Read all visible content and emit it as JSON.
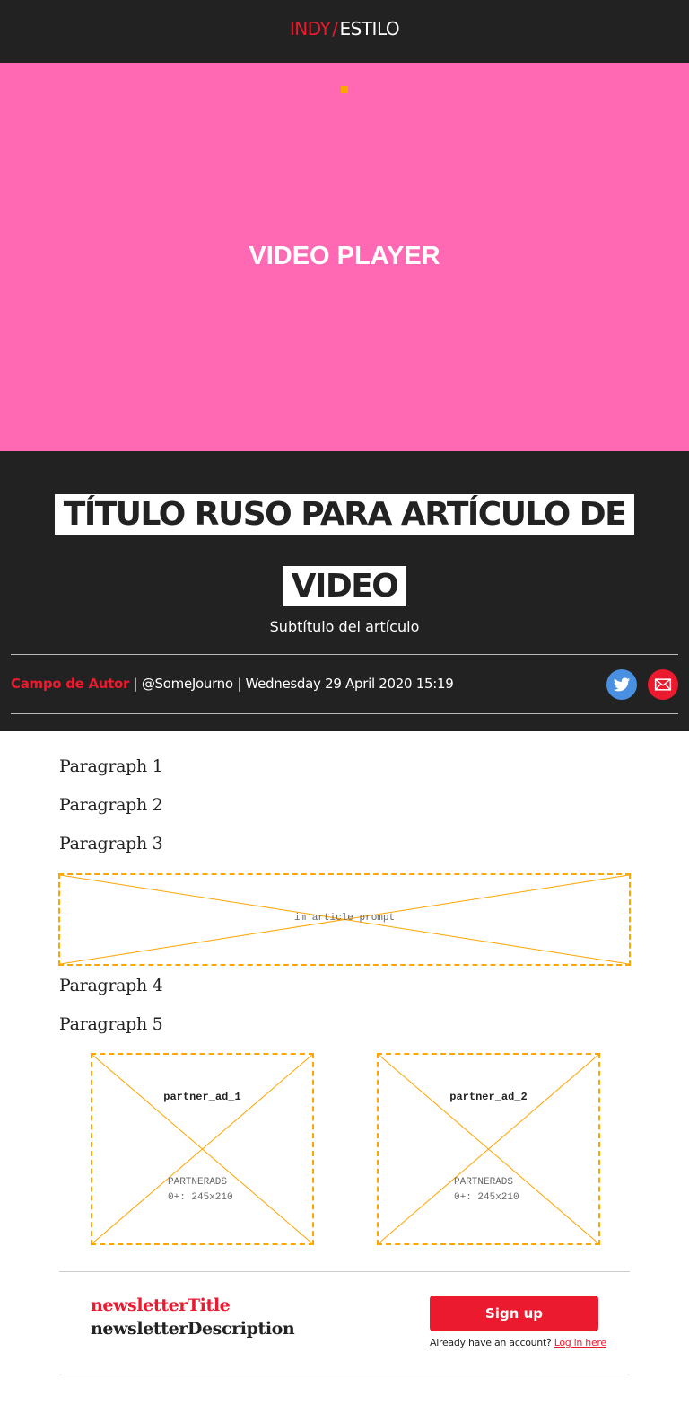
{
  "colors": {
    "brand_red": "#ec1a2e",
    "dark": "#222222",
    "video_bg": "#ff69b4",
    "placeholder": "#ffa500",
    "twitter": "#4a90e2"
  },
  "header": {
    "logo_indy": "INDY",
    "logo_slash": "/",
    "logo_estilo": "ESTILO",
    "corner_icon": "expand-arrows-icon"
  },
  "video": {
    "label": "VIDEO PLAYER"
  },
  "article": {
    "title": "TÍTULO RUSO PARA ARTÍCULO DE VIDEO",
    "subtitle": "Subtítulo del artículo",
    "author": "Campo de Autor",
    "separator": "|",
    "handle": "@SomeJourno",
    "date": "Wednesday 29 April 2020 15:19",
    "share_icons": [
      "twitter-icon",
      "email-icon"
    ]
  },
  "body": {
    "paragraphs": [
      "Paragraph 1",
      "Paragraph 2",
      "Paragraph 3",
      "Paragraph 4",
      "Paragraph 5"
    ],
    "prompt_label": "im article prompt",
    "partner_ads": [
      {
        "name": "partner_ad_1",
        "line1": "PARTNERADS",
        "line2": "0+: 245x210"
      },
      {
        "name": "partner_ad_2",
        "line1": "PARTNERADS",
        "line2": "0+: 245x210"
      }
    ]
  },
  "newsletter": {
    "title": "newsletterTitle",
    "description": "newsletterDescription",
    "signup_label": "Sign up",
    "account_text": "Already have an account?",
    "login_link": "Log in here"
  }
}
